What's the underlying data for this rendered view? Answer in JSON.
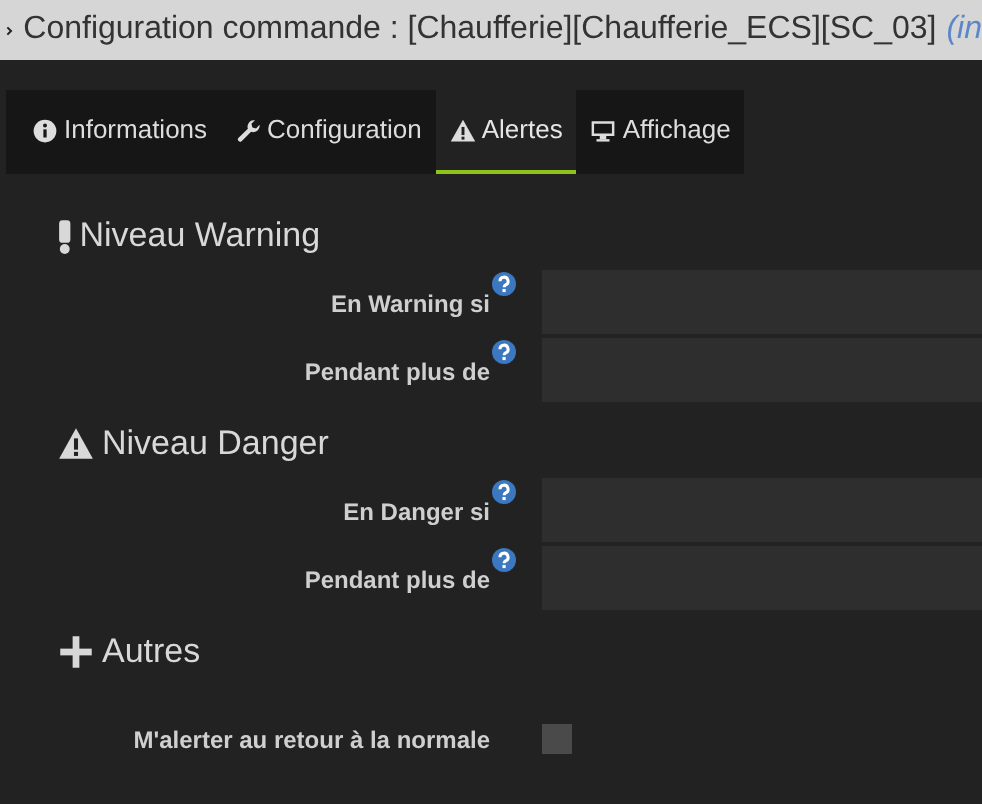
{
  "window": {
    "title": "Configuration commande : [Chaufferie][Chaufferie_ECS][SC_03]",
    "title_suffix": "(in"
  },
  "tabs": [
    {
      "label": "Informations",
      "selected": false
    },
    {
      "label": "Configuration",
      "selected": false
    },
    {
      "label": "Alertes",
      "selected": true
    },
    {
      "label": "Affichage",
      "selected": false
    }
  ],
  "sections": [
    {
      "title": "Niveau Warning",
      "fields": [
        {
          "kind": "text",
          "label": "En Warning si"
        },
        {
          "kind": "text",
          "label": "Pendant plus de"
        }
      ]
    },
    {
      "title": "Niveau Danger",
      "fields": [
        {
          "kind": "text",
          "label": "En Danger si"
        },
        {
          "kind": "text",
          "label": "Pendant plus de"
        }
      ]
    },
    {
      "title": "Autres",
      "fields": [
        {
          "kind": "checkbox",
          "label": "M'alerter au retour à la normale",
          "checked": false
        }
      ]
    }
  ]
}
